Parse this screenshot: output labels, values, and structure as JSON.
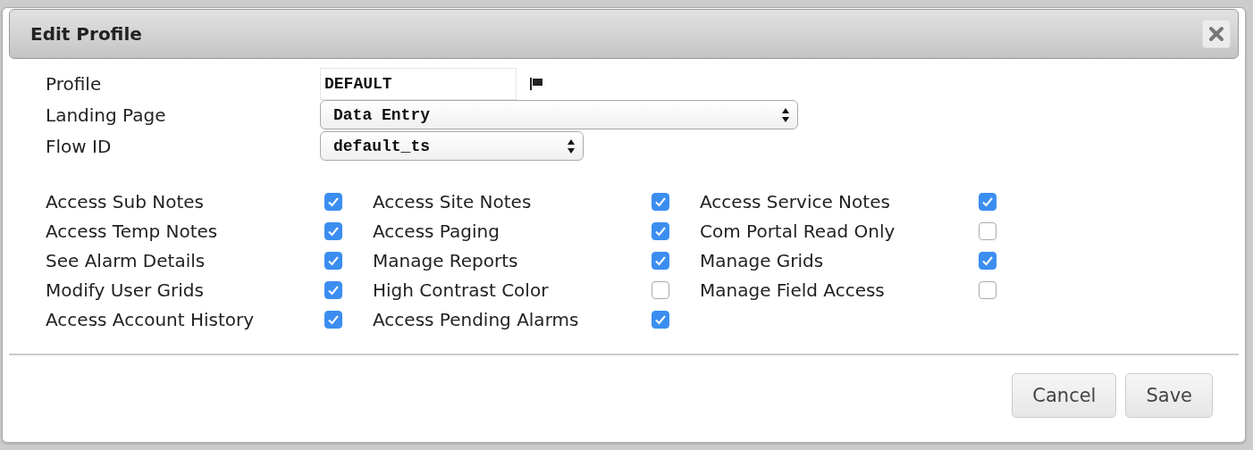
{
  "dialog": {
    "title": "Edit Profile"
  },
  "fields": [
    {
      "label": "Profile",
      "kind": "input",
      "value": "DEFAULT"
    },
    {
      "label": "Landing Page",
      "kind": "select",
      "value": "Data Entry",
      "wide": true
    },
    {
      "label": "Flow ID",
      "kind": "select",
      "value": "default_ts",
      "wide": false
    }
  ],
  "permissions": [
    {
      "label": "Access Sub Notes",
      "checked": true
    },
    {
      "label": "Access Site Notes",
      "checked": true
    },
    {
      "label": "Access Service Notes",
      "checked": true
    },
    {
      "label": "Access Temp Notes",
      "checked": true
    },
    {
      "label": "Access Paging",
      "checked": true
    },
    {
      "label": "Com Portal Read Only",
      "checked": false
    },
    {
      "label": "See Alarm Details",
      "checked": true
    },
    {
      "label": "Manage Reports",
      "checked": true
    },
    {
      "label": "Manage Grids",
      "checked": true
    },
    {
      "label": "Modify User Grids",
      "checked": true
    },
    {
      "label": "High Contrast Color",
      "checked": false
    },
    {
      "label": "Manage Field Access",
      "checked": false
    },
    {
      "label": "Access Account History",
      "checked": true
    },
    {
      "label": "Access Pending Alarms",
      "checked": true
    }
  ],
  "buttons": [
    "Cancel",
    "Save"
  ]
}
